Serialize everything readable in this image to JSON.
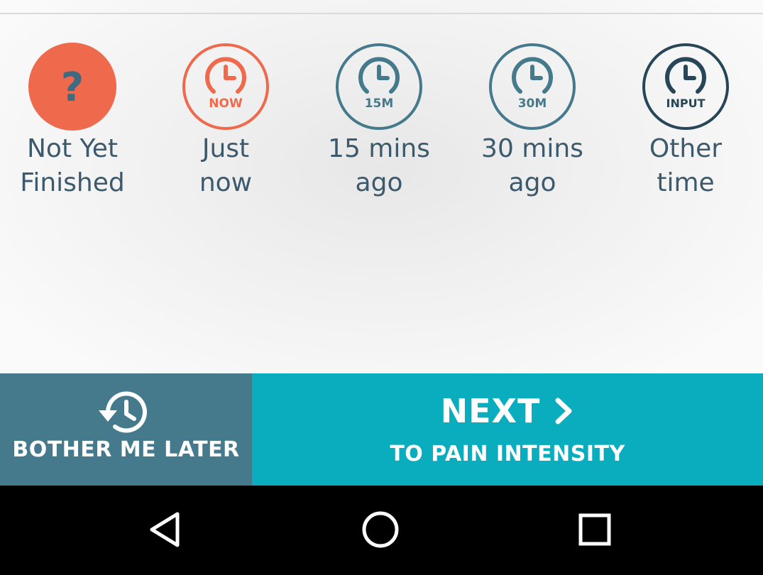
{
  "options": [
    {
      "id": "not-yet",
      "label": "Not Yet\nFinished",
      "icon_text": "?",
      "icon": "question-icon"
    },
    {
      "id": "now",
      "label": "Just\nnow",
      "icon_text": "NOW",
      "icon": "clock-now-icon"
    },
    {
      "id": "15m",
      "label": "15 mins\nago",
      "icon_text": "15M",
      "icon": "clock-15m-icon"
    },
    {
      "id": "30m",
      "label": "30 mins\nago",
      "icon_text": "30M",
      "icon": "clock-30m-icon"
    },
    {
      "id": "input",
      "label": "Other\ntime",
      "icon_text": "INPUT",
      "icon": "clock-input-icon"
    }
  ],
  "bother_later": {
    "label": "BOTHER ME LATER",
    "icon": "history-icon"
  },
  "next": {
    "label": "NEXT",
    "sublabel": "TO PAIN INTENSITY",
    "icon": "chevron-right-icon"
  },
  "nav": {
    "back": "back-icon",
    "home": "home-icon",
    "recents": "recents-icon"
  },
  "colors": {
    "orange": "#ef6a4c",
    "blue_gray": "#457a8c",
    "dark_navy": "#274657",
    "teal": "#09adbd",
    "label": "#3c5a6c"
  }
}
